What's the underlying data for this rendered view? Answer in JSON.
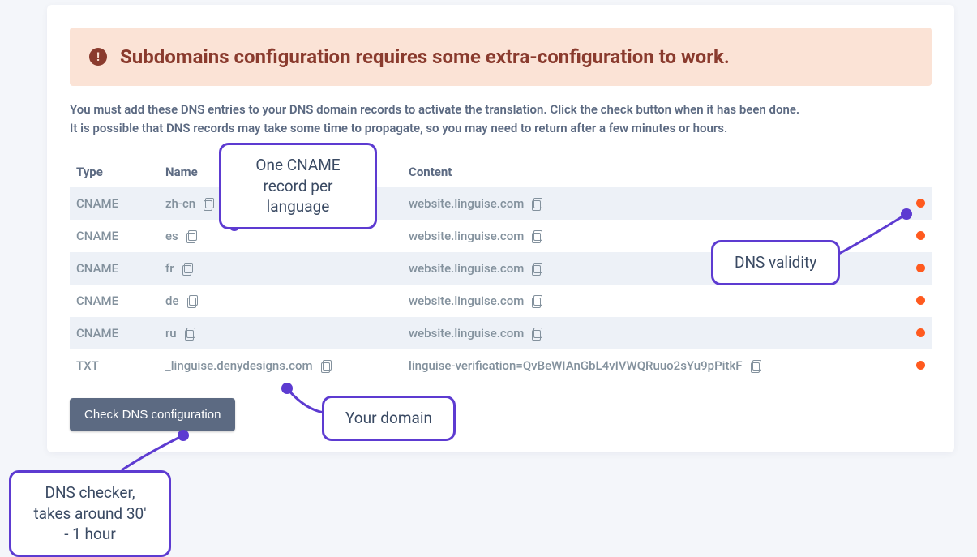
{
  "alert": {
    "title": "Subdomains configuration requires some extra-configuration to work."
  },
  "instructions": {
    "line1": "You must add these DNS entries to your DNS domain records to activate the translation. Click the check button when it has been done.",
    "line2": "It is possible that DNS records may take some time to propagate, so you may need to return after a few minutes or hours."
  },
  "table": {
    "headers": {
      "type": "Type",
      "name": "Name",
      "content": "Content"
    },
    "rows": [
      {
        "type": "CNAME",
        "name": "zh-cn",
        "content": "website.linguise.com"
      },
      {
        "type": "CNAME",
        "name": "es",
        "content": "website.linguise.com"
      },
      {
        "type": "CNAME",
        "name": "fr",
        "content": "website.linguise.com"
      },
      {
        "type": "CNAME",
        "name": "de",
        "content": "website.linguise.com"
      },
      {
        "type": "CNAME",
        "name": "ru",
        "content": "website.linguise.com"
      },
      {
        "type": "TXT",
        "name": "_linguise.denydesigns.com",
        "content": "linguise-verification=QvBeWIAnGbL4vIVWQRuuo2sYu9pPitkF"
      }
    ]
  },
  "button": {
    "check_dns": "Check DNS configuration"
  },
  "callouts": {
    "cname": "One CNAME record per language",
    "validity": "DNS validity",
    "domain": "Your domain",
    "checker": "DNS checker, takes around 30' - 1 hour"
  }
}
